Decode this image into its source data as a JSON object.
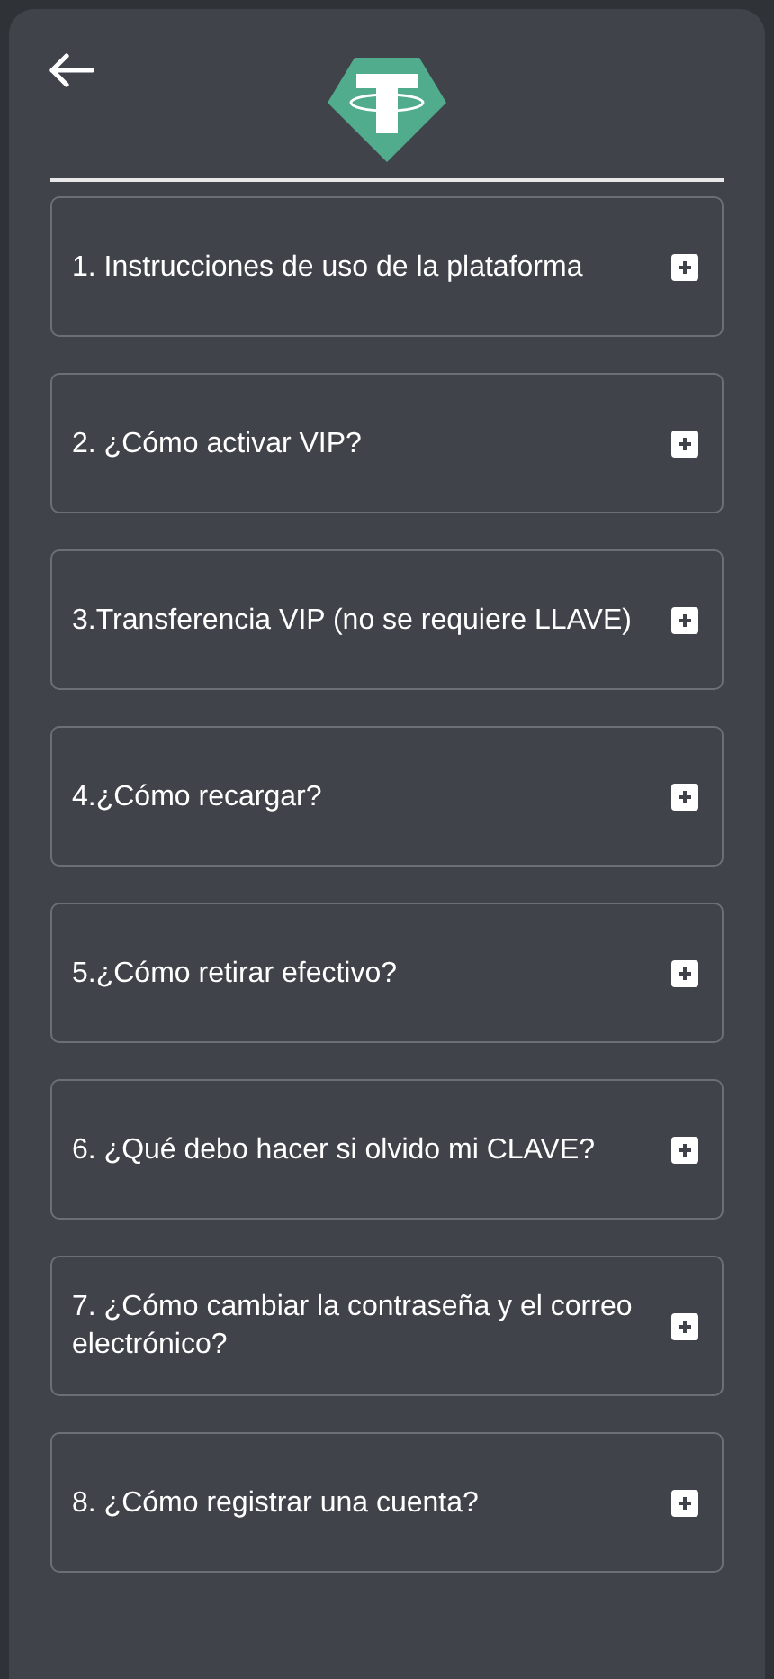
{
  "items": [
    {
      "title": "1. Instrucciones de uso de la plataforma",
      "expanded": false
    },
    {
      "title": "2. ¿Cómo activar VIP?",
      "expanded": false
    },
    {
      "title": "3.Transferencia VIP (no se requiere LLAVE)",
      "expanded": false
    },
    {
      "title": "4.¿Cómo recargar?",
      "expanded": false
    },
    {
      "title": "5.¿Cómo retirar efectivo?",
      "expanded": false
    },
    {
      "title": "6. ¿Qué debo hacer si olvido mi CLAVE?",
      "expanded": false
    },
    {
      "title": "7. ¿Cómo cambiar la contraseña y el correo electrónico?",
      "expanded": false
    },
    {
      "title": "8. ¿Cómo registrar una cuenta?",
      "expanded": false
    }
  ]
}
